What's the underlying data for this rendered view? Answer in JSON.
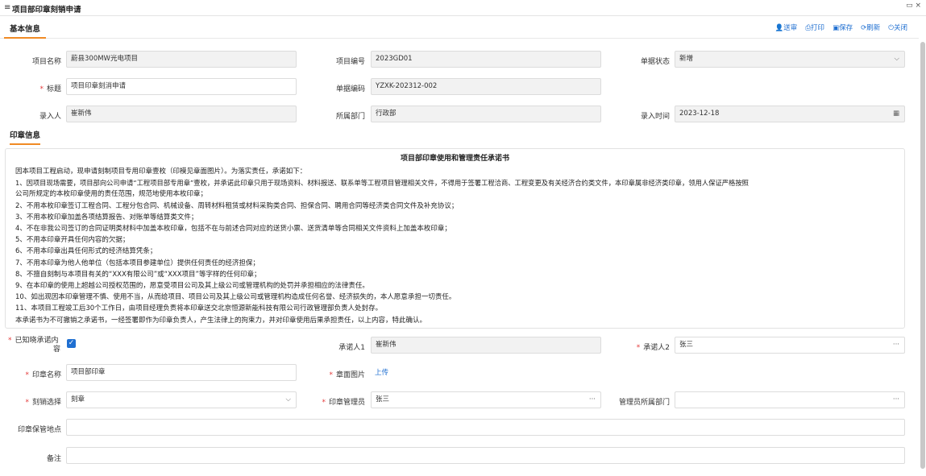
{
  "window": {
    "title": "项目部印章刻销申请",
    "menu_icon": "≡",
    "win_buttons": "▭ ×"
  },
  "tabs": {
    "basic": "基本信息"
  },
  "toolbar": {
    "send": "送审",
    "print": "打印",
    "save": "保存",
    "refresh": "刷新",
    "close": "关闭",
    "icons": {
      "send": "user-send-icon",
      "print": "printer-icon",
      "save": "save-icon",
      "refresh": "refresh-icon",
      "close": "power-icon"
    }
  },
  "basic": {
    "project_name_label": "项目名称",
    "project_name": "蔚县300MW光电项目",
    "project_code_label": "项目编号",
    "project_code": "2023GD01",
    "doc_status_label": "单据状态",
    "doc_status": "新增",
    "title_label": "标题",
    "title": "项目印章刻消申请",
    "doc_code_label": "单据编码",
    "doc_code": "YZXK-202312-002",
    "entry_person_label": "录入人",
    "entry_person": "崔新伟",
    "dept_label": "所属部门",
    "dept": "行政部",
    "entry_time_label": "录入时间",
    "entry_time": "2023-12-18"
  },
  "seal_section": {
    "title": "印章信息"
  },
  "pledge": {
    "title": "项目部印章使用和管理责任承诺书",
    "lines": [
      "因本项目工程启动，现申请刻制项目专用印章壹枚（印模见章面图片）。为落实责任，承诺如下：",
      "1、因项目现场需要，项目部向公司申请“工程项目部专用章”壹枚，并承诺此印章只用于现场资料、材料报送、联系单等工程项目管理相关文件，不得用于签署工程洽商、工程变更及有关经济合约类文件，本印章属非经济类印章，领用人保证严格按照",
      "公司所规定的本枚印章使用的责任范围，规范地使用本枚印章；",
      "2、不用本枚印章签订工程合同、工程分包合同、机械设备、周转材料租赁或材料采购类合同、担保合同、聘用合同等经济类合同文件及补充协议；",
      "3、不用本枚印章加盖各项结算报告、对账单等结算类文件；",
      "4、不在非我公司签订的合同证明类材料中加盖本枚印章，包括不在与前述合同对应的送货小票、送货清单等合同相关文件资料上加盖本枚印章；",
      "5、不用本印章开具任何内容的欠据；",
      "6、不用本印章出具任何形式的经济结算凭条；",
      "7、不用本印章为他人他单位（包括本项目参建单位）提供任何责任的经济担保；",
      "8、不擅自刻制与本项目有关的“XXX有限公司”或“XXX项目”等字样的任何印章；",
      "9、在本印章的使用上超越公司授权范围的，愿意受项目公司及其上级公司或管理机构的处罚并承担相应的法律责任。",
      "10、如出现因本印章管理不慎、使用不当，从而给项目、项目公司及其上级公司或管理机构造成任何名誉、经济损失的，本人愿意承担一切责任。",
      "11、本项目工程竣工后30个工作日，由项目经理负责将本印章送交北京恒源新能科技有限公司行政管理部负责人处封存。",
      "本承诺书为不可撤销之承诺书，一经签署即作为印章负责人，产生法律上的拘束力，并对印章使用后果承担责任，以上内容，特此确认。"
    ]
  },
  "form": {
    "known_label": "已知晓承诺内容",
    "known_label_l1": "已知晓承诺内",
    "known_label_l2": "容",
    "known_checked": "✓",
    "promiser1_label": "承诺人1",
    "promiser1": "崔新伟",
    "promiser2_label": "承诺人2",
    "promiser2": "张三",
    "seal_name_label": "印章名称",
    "seal_name": "项目部印章",
    "seal_image_label": "章面图片",
    "upload": "上传",
    "carve_label": "刻销选择",
    "carve": "刻章",
    "seal_admin_label": "印章管理员",
    "seal_admin": "张三",
    "admin_dept_label": "管理员所属部门",
    "admin_dept": "",
    "keep_place_label": "印章保管地点",
    "keep_place": "",
    "remark_label": "备注",
    "remark": ""
  },
  "suffix": {
    "more": "···",
    "chevron": "⌵",
    "calendar": "▦"
  }
}
